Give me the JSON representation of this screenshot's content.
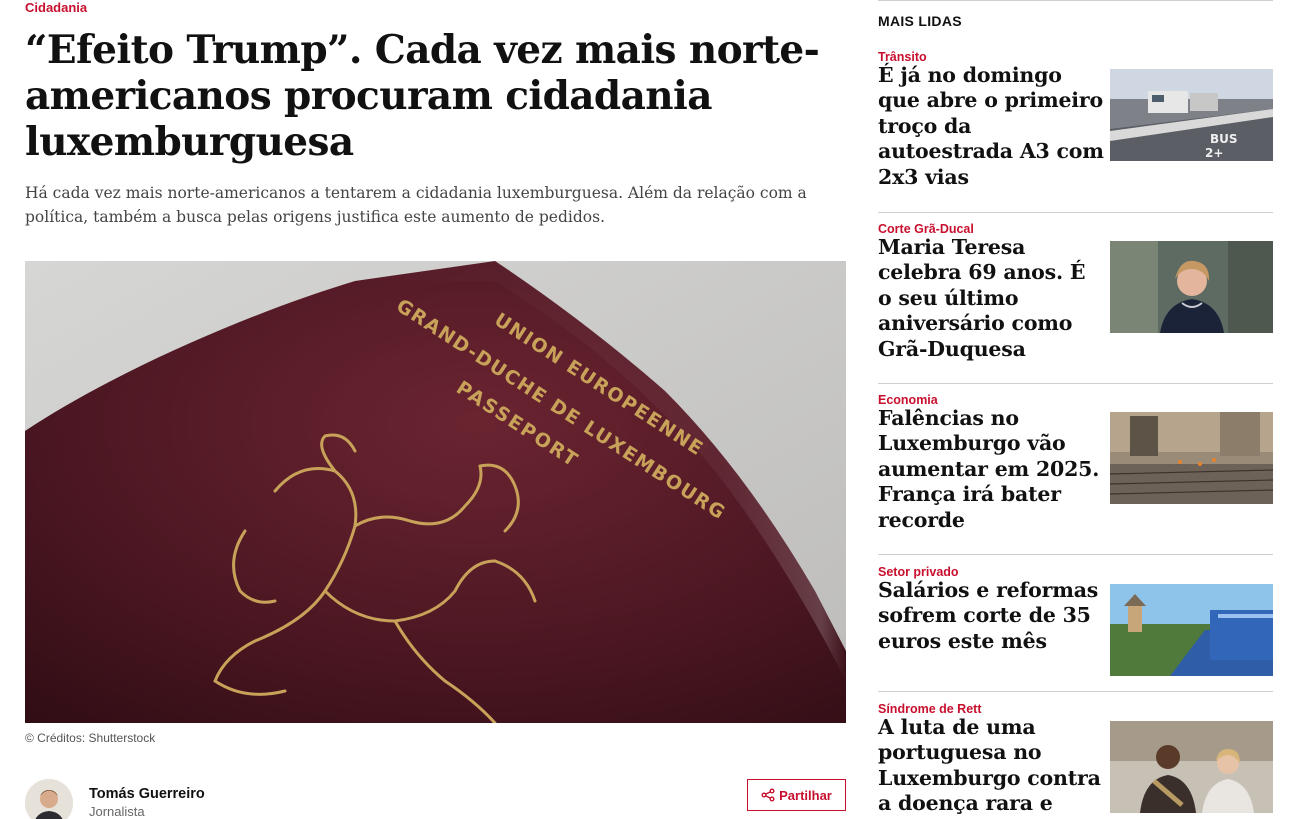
{
  "article": {
    "category": "Cidadania",
    "headline": "“Efeito Trump”. Cada vez mais norte-americanos procuram cidadania luxemburguesa",
    "lead": "Há cada vez mais norte-americanos a tentarem a cidadania luxemburguesa. Além da relação com a política, também a busca pelas origens justifica este aumento de pedidos.",
    "image_credit": "© Créditos: Shutterstock",
    "passport_text": [
      "UNION EUROPEENNE",
      "GRAND-DUCHE DE LUXEMBOURG",
      "PASSEPORT"
    ],
    "author": {
      "name": "Tomás Guerreiro",
      "role": "Jornalista"
    },
    "share_label": "Partilhar"
  },
  "sidebar": {
    "title": "MAIS LIDAS",
    "items": [
      {
        "category": "Trânsito",
        "title": "É já no domingo que abre o primeiro troço da autoestrada A3 com 2x3 vias"
      },
      {
        "category": "Corte Grã-Ducal",
        "title": "Maria Teresa celebra 69 anos. É o seu último aniversário como Grã-Duquesa"
      },
      {
        "category": "Economia",
        "title": "Falências no Luxemburgo vão aumentar em 2025. França irá bater recorde"
      },
      {
        "category": "Setor privado",
        "title": "Salários e reformas sofrem corte de 35 euros este mês"
      },
      {
        "category": "Síndrome de Rett",
        "title": "A luta de uma portuguesa no Luxemburgo contra a doença rara e sem"
      }
    ]
  },
  "colors": {
    "accent": "#c8102e",
    "text": "#111111",
    "muted": "#444444",
    "rule": "#cfcfcf",
    "passport": "#4a1620",
    "gold": "#c9a25a"
  },
  "icons": {
    "share": "share-icon"
  }
}
